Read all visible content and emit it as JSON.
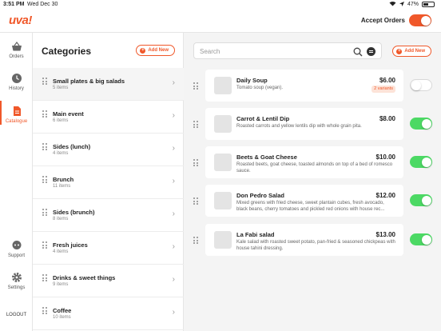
{
  "status_bar": {
    "time": "3:51 PM",
    "date": "Wed Dec 30",
    "battery": "47%",
    "battery_level": 0.47
  },
  "header": {
    "logo": "uva!",
    "accept_orders_label": "Accept Orders",
    "accept_orders_on": true
  },
  "colors": {
    "accent": "#f0582a",
    "toggle_on": "#4cd964",
    "toggle_accept": "#f0582a"
  },
  "rail": {
    "items": [
      {
        "label": "Orders",
        "icon": "basket-icon"
      },
      {
        "label": "History",
        "icon": "clock-icon"
      },
      {
        "label": "Catalogue",
        "icon": "document-icon",
        "active": true
      },
      {
        "label": "Support",
        "icon": "chat-icon"
      },
      {
        "label": "Settings",
        "icon": "gear-icon"
      }
    ],
    "logout": "LOGOUT"
  },
  "categories": {
    "title": "Categories",
    "add_label": "Add New",
    "items": [
      {
        "name": "Small plates & big salads",
        "count": "5 items"
      },
      {
        "name": "Main event",
        "count": "6 items"
      },
      {
        "name": "Sides (lunch)",
        "count": "4 items"
      },
      {
        "name": "Brunch",
        "count": "11 items"
      },
      {
        "name": "Sides (brunch)",
        "count": "8 items"
      },
      {
        "name": "Fresh juices",
        "count": "4 items"
      },
      {
        "name": "Drinks & sweet things",
        "count": "9 items"
      },
      {
        "name": "Coffee",
        "count": "10 items"
      }
    ]
  },
  "items_pane": {
    "search_placeholder": "Search",
    "add_label": "Add New",
    "items": [
      {
        "name": "Daily Soup",
        "description": "Tomato soup (vegan).",
        "price": "$6.00",
        "variants": "2 variants",
        "enabled": false
      },
      {
        "name": "Carrot & Lentil Dip",
        "description": "Roasted carrots and yellow lentils dip with whole grain pita.",
        "price": "$8.00",
        "enabled": true
      },
      {
        "name": "Beets & Goat Cheese",
        "description": "Roasted beets, goat cheese, toasted almonds on top of a bed of romesco sauce.",
        "price": "$10.00",
        "enabled": true
      },
      {
        "name": "Don Pedro Salad",
        "description": "Mixed greens with fried cheese, sweet plantain cubes, fresh avocado, black beans, cherry tomatoes and pickled red onions with house rec...",
        "price": "$12.00",
        "enabled": true
      },
      {
        "name": "La Fabi salad",
        "description": "Kale salad with roasted sweet potato, pan-fried & seasoned chickpeas with house tahini dressing.",
        "price": "$13.00",
        "enabled": true
      }
    ]
  }
}
